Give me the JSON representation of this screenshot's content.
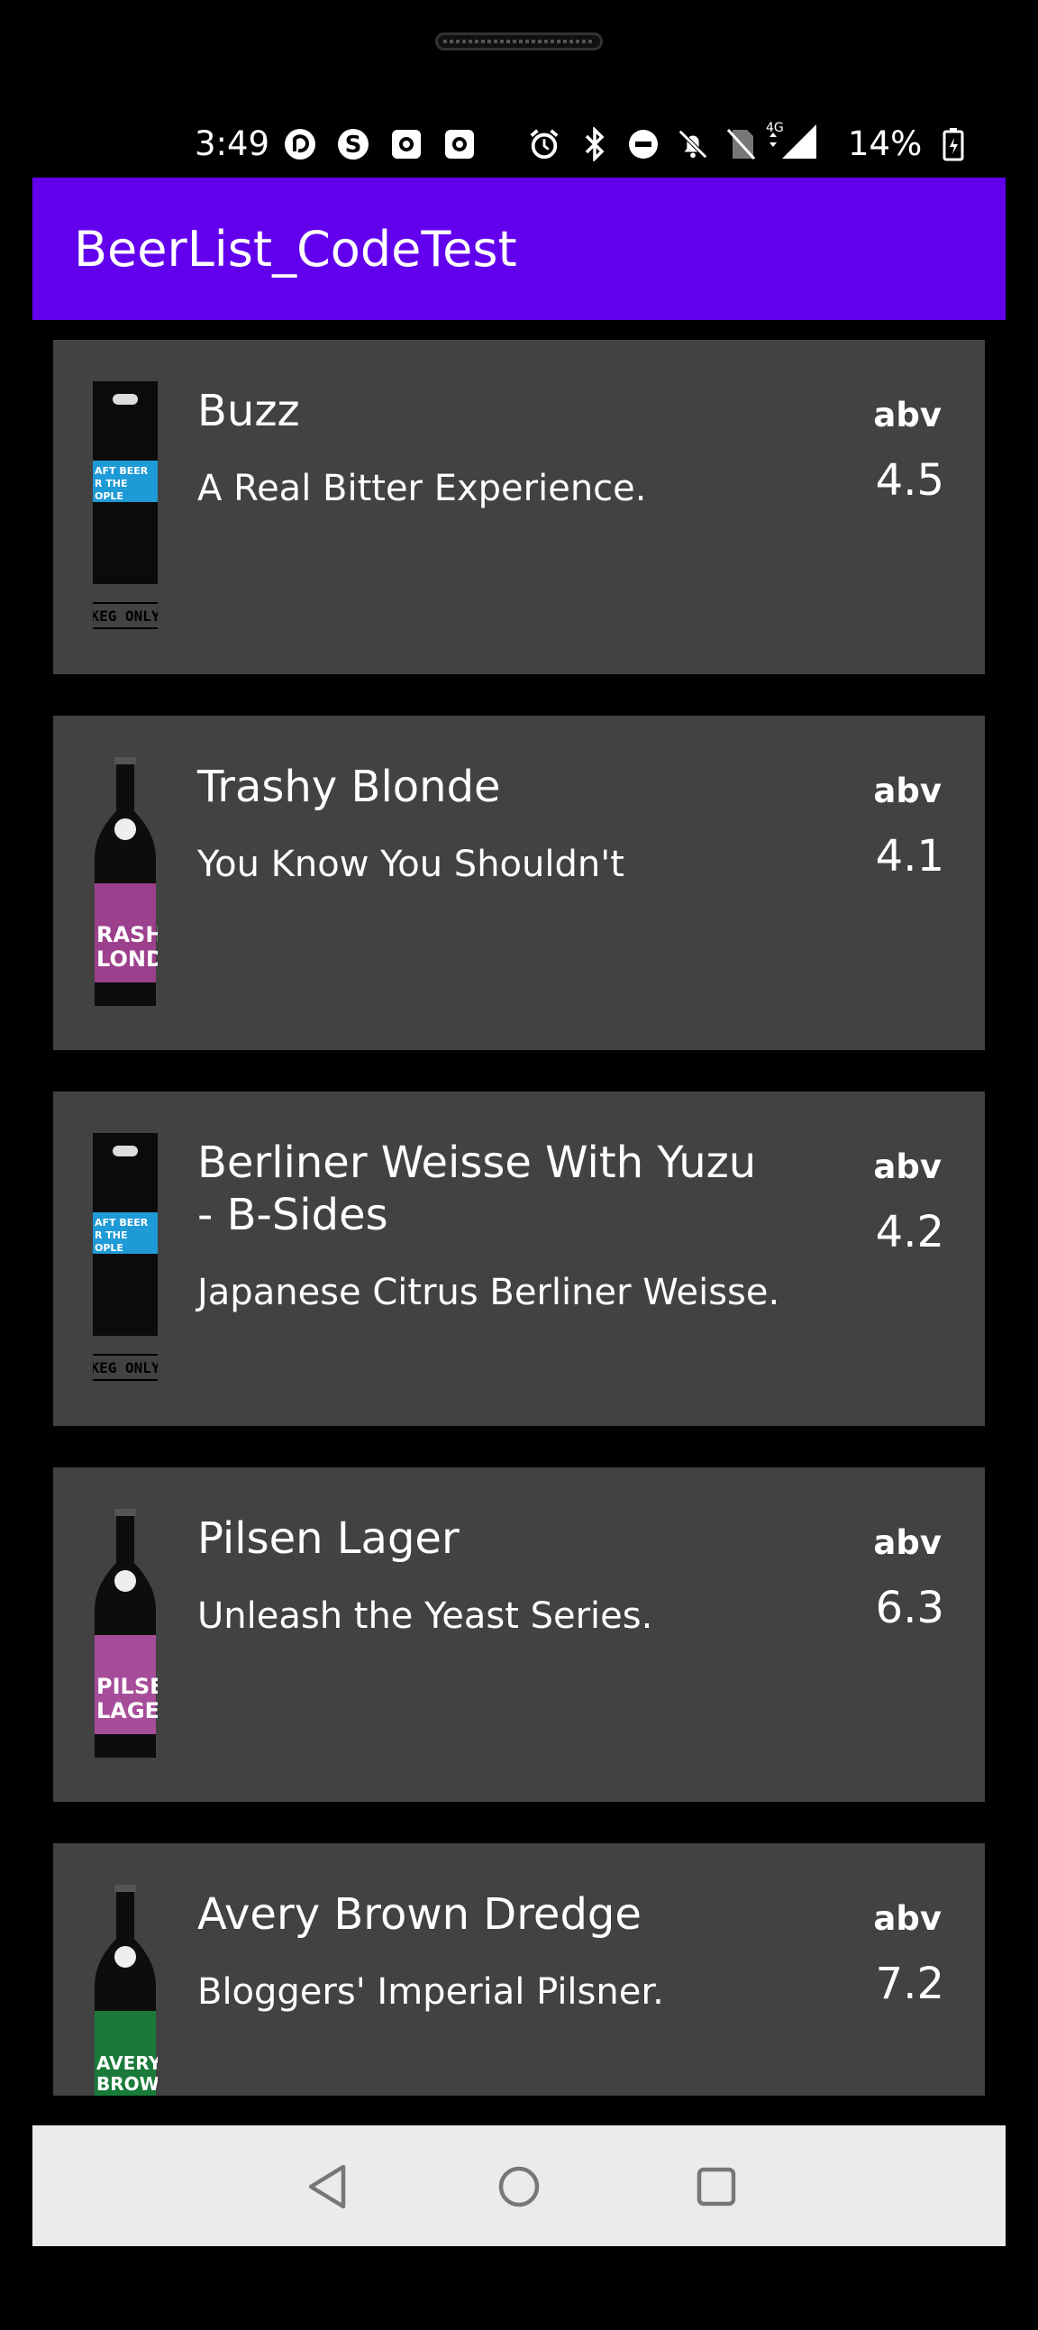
{
  "status_bar": {
    "time": "3:49",
    "battery_percent": "14%",
    "network": "4G",
    "icons": [
      "pocket-casts-icon",
      "skype-icon",
      "camera-icon",
      "camera-icon",
      "alarm-icon",
      "bluetooth-icon",
      "dnd-icon",
      "notifications-off-icon",
      "no-sim-icon",
      "signal-icon",
      "battery-icon"
    ]
  },
  "app_bar": {
    "title": "BeerList_CodeTest",
    "color": "#6200EE"
  },
  "beers": [
    {
      "name": "Buzz",
      "tagline": "A Real Bitter Experience.",
      "abv_label": "abv",
      "abv": "4.5",
      "image": "keg",
      "label_color": "#1e9ad6",
      "keg_text": "KEG ONLY"
    },
    {
      "name": "Trashy Blonde",
      "tagline": "You Know You Shouldn't",
      "abv_label": "abv",
      "abv": "4.1",
      "image": "bottle",
      "label_color": "#9c3f8c"
    },
    {
      "name": "Berliner Weisse With Yuzu - B-Sides",
      "tagline": "Japanese Citrus Berliner Weisse.",
      "abv_label": "abv",
      "abv": "4.2",
      "image": "keg",
      "label_color": "#1e9ad6",
      "keg_text": "KEG ONLY"
    },
    {
      "name": "Pilsen Lager",
      "tagline": "Unleash the Yeast Series.",
      "abv_label": "abv",
      "abv": "6.3",
      "image": "bottle",
      "label_color": "#a64c99"
    },
    {
      "name": "Avery Brown Dredge",
      "tagline": "Bloggers' Imperial Pilsner.",
      "abv_label": "abv",
      "abv": "7.2",
      "image": "bottle",
      "label_color": "#1a7a3a"
    }
  ],
  "nav_bar": {
    "buttons": [
      "back-icon",
      "home-icon",
      "recents-icon"
    ]
  }
}
